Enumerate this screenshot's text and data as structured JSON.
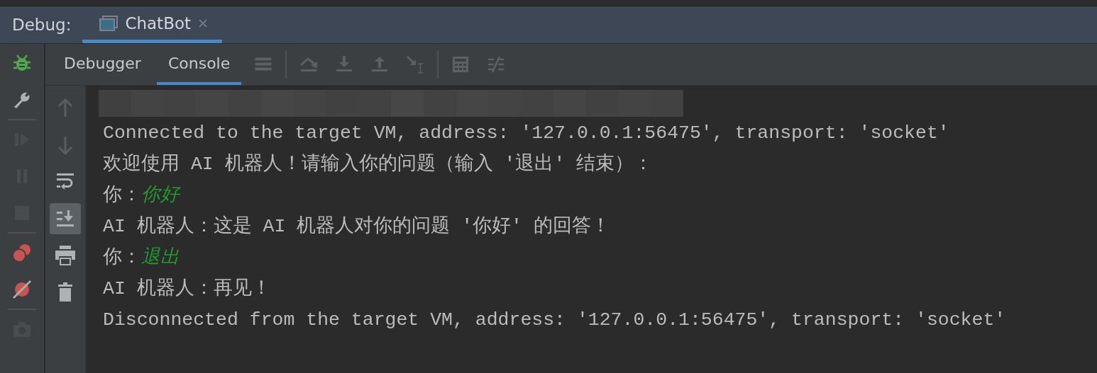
{
  "debug_bar": {
    "label": "Debug:",
    "tabs": [
      {
        "label": "ChatBot",
        "selected": true
      }
    ]
  },
  "left_rail": [
    {
      "kind": "bug",
      "disabled": false
    },
    {
      "kind": "wrench",
      "disabled": false
    },
    {
      "kind": "resume",
      "disabled": true
    },
    {
      "kind": "pause",
      "disabled": true
    },
    {
      "kind": "stop",
      "disabled": true
    },
    {
      "kind": "breakpoints",
      "disabled": false
    },
    {
      "kind": "mute",
      "disabled": false
    },
    {
      "kind": "camera",
      "disabled": true
    }
  ],
  "toolbar": {
    "tabs": [
      {
        "label": "Debugger",
        "selected": false
      },
      {
        "label": "Console",
        "selected": true
      }
    ],
    "icons": [
      {
        "kind": "layout",
        "disabled": true
      },
      {
        "kind": "step_over",
        "disabled": true
      },
      {
        "kind": "step_into",
        "disabled": true
      },
      {
        "kind": "step_out",
        "disabled": true
      },
      {
        "kind": "run_to_cursor",
        "disabled": true
      },
      {
        "kind": "evaluate",
        "disabled": true
      },
      {
        "kind": "trace",
        "disabled": true
      }
    ]
  },
  "console_tools": [
    {
      "kind": "up",
      "on": false,
      "disabled": true
    },
    {
      "kind": "down",
      "on": false,
      "disabled": true
    },
    {
      "kind": "wrap",
      "on": false,
      "disabled": false
    },
    {
      "kind": "scroll_end",
      "on": true,
      "disabled": false
    },
    {
      "kind": "print",
      "on": false,
      "disabled": false
    },
    {
      "kind": "clear",
      "on": false,
      "disabled": false
    }
  ],
  "console": [
    {
      "kind": "blurred"
    },
    {
      "kind": "text",
      "text": "Connected to the target VM, address: '127.0.0.1:56475', transport: 'socket'"
    },
    {
      "kind": "text",
      "text": "欢迎使用 AI 机器人！请输入你的问题（输入 '退出' 结束）："
    },
    {
      "kind": "input",
      "prompt": "你：",
      "text": "你好"
    },
    {
      "kind": "text",
      "text": "AI 机器人：这是 AI 机器人对你的问题 '你好' 的回答！"
    },
    {
      "kind": "input",
      "prompt": "你：",
      "text": "退出"
    },
    {
      "kind": "text",
      "text": "AI 机器人：再见！"
    },
    {
      "kind": "text",
      "text": "Disconnected from the target VM, address: '127.0.0.1:56475', transport: 'socket'"
    }
  ]
}
